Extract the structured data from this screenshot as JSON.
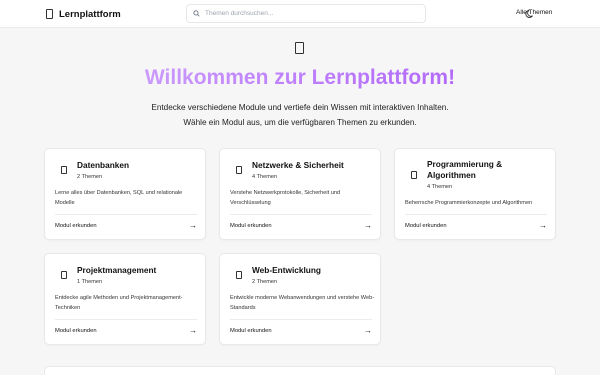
{
  "header": {
    "title": "Lernplattform",
    "search_placeholder": "Themen durchsuchen...",
    "all_topics": "Alle Themen"
  },
  "hero": {
    "title": "Willkommen zur Lernplattform!",
    "line1": "Entdecke verschiedene Module und vertiefe dein Wissen mit interaktiven Inhalten.",
    "line2": "Wähle ein Modul aus, um die verfügbaren Themen zu erkunden."
  },
  "modules": [
    {
      "title": "Datenbanken",
      "count": "2 Themen",
      "desc": "Lerne alles über Datenbanken, SQL und relationale Modelle",
      "link": "Modul erkunden"
    },
    {
      "title": "Netzwerke & Sicherheit",
      "count": "4 Themen",
      "desc": "Verstehe Netzwerkprotokolle, Sicherheit und Verschlüsselung",
      "link": "Modul erkunden"
    },
    {
      "title": "Programmierung & Algorithmen",
      "count": "4 Themen",
      "desc": "Beherrsche Programmierkonzepte und Algorithmen",
      "link": "Modul erkunden"
    },
    {
      "title": "Projektmanagement",
      "count": "1 Themen",
      "desc": "Entdecke agile Methoden und Projektmanagement-Techniken",
      "link": "Modul erkunden"
    },
    {
      "title": "Web-Entwicklung",
      "count": "2 Themen",
      "desc": "Entwickle moderne Webanwendungen und verstehe Web-Standards",
      "link": "Modul erkunden"
    }
  ]
}
